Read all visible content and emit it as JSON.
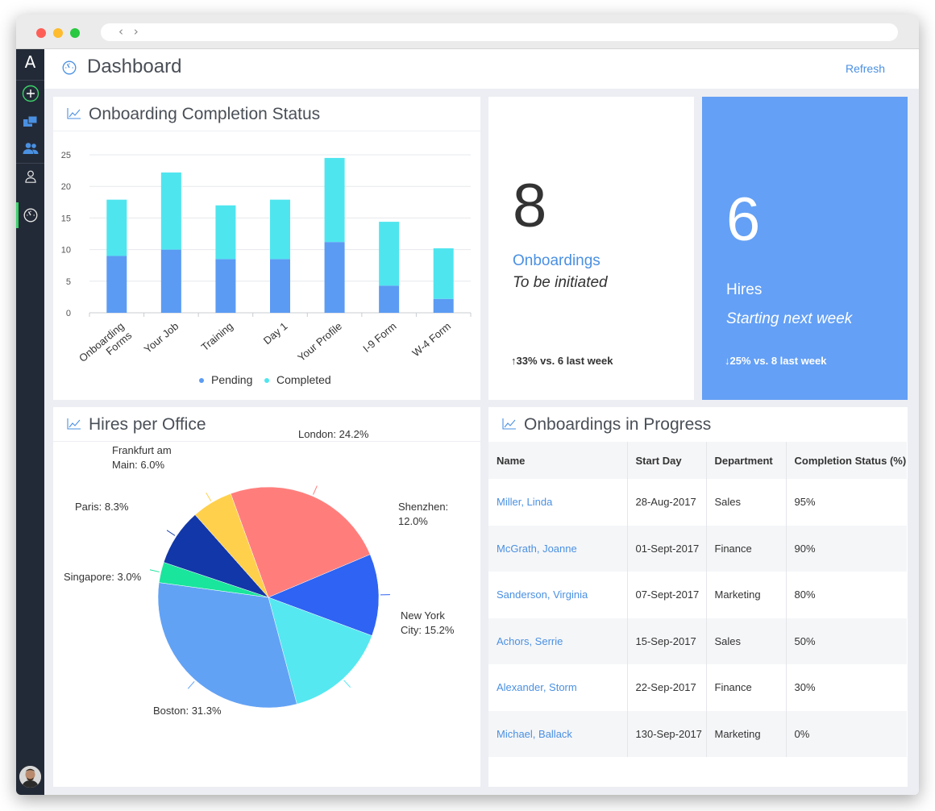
{
  "app": {
    "logo": "A",
    "header": {
      "title": "Dashboard",
      "refresh_label": "Refresh"
    }
  },
  "sidebar": {
    "items": [
      {
        "icon": "plus-circle-icon"
      },
      {
        "icon": "folders-icon"
      },
      {
        "icon": "users-icon"
      },
      {
        "icon": "person-icon"
      },
      {
        "icon": "dashboard-gauge-icon",
        "active": true
      }
    ],
    "accent": "#3bd36b"
  },
  "onboarding_chart": {
    "title": "Onboarding Completion Status",
    "legend": [
      "Pending",
      "Completed"
    ]
  },
  "kpi_onboardings": {
    "value": "8",
    "label": "Onboardings",
    "sub": "To be initiated",
    "trend": "↑33% vs. 6 last week"
  },
  "kpi_hires": {
    "value": "6",
    "label": "Hires",
    "sub": "Starting next week",
    "trend": "↓25% vs. 8 last week",
    "bg_color": "#64a0f5"
  },
  "hires_per_office": {
    "title": "Hires per Office"
  },
  "progress_table": {
    "title": "Onboardings in Progress",
    "columns": [
      "Name",
      "Start Day",
      "Department",
      "Completion Status (%)"
    ],
    "rows": [
      {
        "name": "Miller, Linda",
        "start": "28-Aug-2017",
        "dept": "Sales",
        "status": "95%"
      },
      {
        "name": "McGrath, Joanne",
        "start": "01-Sept-2017",
        "dept": "Finance",
        "status": "90%"
      },
      {
        "name": "Sanderson, Virginia",
        "start": "07-Sept-2017",
        "dept": "Marketing",
        "status": "80%"
      },
      {
        "name": "Achors, Serrie",
        "start": "15-Sep-2017",
        "dept": "Sales",
        "status": "50%"
      },
      {
        "name": "Alexander, Storm",
        "start": "22-Sep-2017",
        "dept": "Finance",
        "status": "30%"
      },
      {
        "name": "Michael, Ballack",
        "start": "130-Sep-2017",
        "dept": "Marketing",
        "status": "0%"
      }
    ]
  },
  "chart_data": [
    {
      "type": "bar",
      "stacked": true,
      "title": "Onboarding Completion Status",
      "categories": [
        "Onboarding Forms",
        "Your Job",
        "Training",
        "Day 1",
        "Your Profile",
        "I-9 Form",
        "W-4 Form"
      ],
      "series": [
        {
          "name": "Pending",
          "values": [
            9,
            10,
            8.5,
            8.5,
            11.2,
            4.3,
            2.2
          ],
          "color": "#5b9bf3"
        },
        {
          "name": "Completed",
          "values": [
            8.9,
            12.2,
            8.5,
            9.4,
            13.3,
            10.1,
            8
          ],
          "color": "#4fe5ef"
        }
      ],
      "yticks": [
        0,
        5,
        10,
        15,
        20,
        25
      ],
      "ylim": [
        0,
        25
      ],
      "grid": true,
      "legend_position": "bottom"
    },
    {
      "type": "pie",
      "title": "Hires per Office",
      "slices": [
        {
          "label": "London: 24.2%",
          "value": 24.2,
          "color": "#ff7e7c"
        },
        {
          "label": "Shenzhen: 12.0%",
          "value": 12.0,
          "color": "#2e63f3"
        },
        {
          "label": "New York City: 15.2%",
          "value": 15.2,
          "color": "#55e8f0"
        },
        {
          "label": "Boston: 31.3%",
          "value": 31.3,
          "color": "#62a2f5"
        },
        {
          "label": "Singapore: 3.0%",
          "value": 3.0,
          "color": "#19e59c"
        },
        {
          "label": "Paris: 8.3%",
          "value": 8.3,
          "color": "#1237a8"
        },
        {
          "label": "Frankfurt am Main: 6.0%",
          "value": 6.0,
          "color": "#ffd04c"
        }
      ]
    }
  ]
}
